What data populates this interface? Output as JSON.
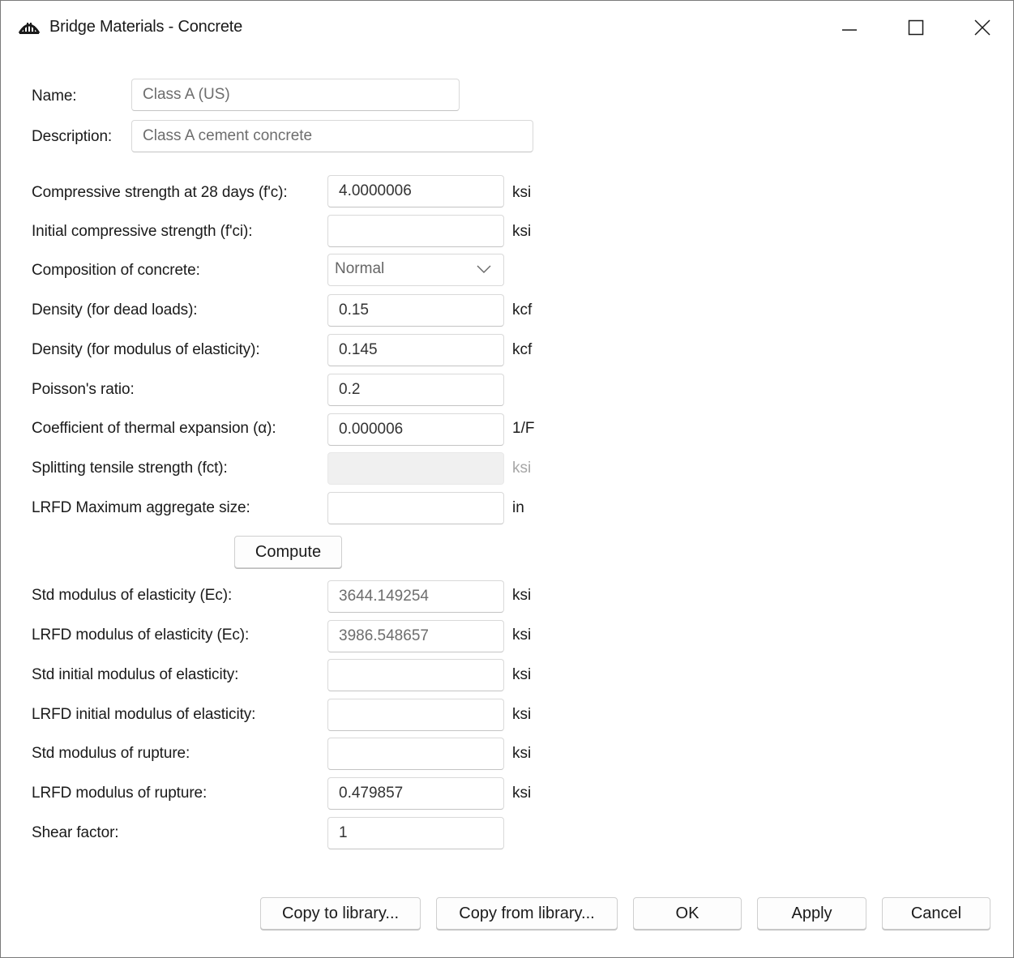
{
  "window": {
    "title": "Bridge Materials - Concrete",
    "app_icon": "bridge-icon",
    "controls": [
      "minimize-icon",
      "maximize-icon",
      "close-icon"
    ]
  },
  "identity": {
    "name_label": "Name:",
    "name_value": "Class A (US)",
    "description_label": "Description:",
    "description_value": "Class A cement concrete"
  },
  "properties": [
    {
      "label": "Compressive strength at 28 days (f'c):",
      "value": "4.0000006",
      "unit": "ksi"
    },
    {
      "label": "Initial compressive strength (f'ci):",
      "value": "",
      "unit": "ksi"
    },
    {
      "label": "Composition of concrete:",
      "value": "Normal",
      "unit": ""
    },
    {
      "label": "Density (for dead loads):",
      "value": "0.15",
      "unit": "kcf"
    },
    {
      "label": "Density (for modulus of elasticity):",
      "value": "0.145",
      "unit": "kcf"
    },
    {
      "label": "Poisson's ratio:",
      "value": "0.2",
      "unit": ""
    },
    {
      "label": "Coefficient of thermal expansion (α):",
      "value": "0.000006",
      "unit": "1/F"
    },
    {
      "label": "Splitting tensile strength (fct):",
      "value": "",
      "unit": "ksi"
    },
    {
      "label": "LRFD Maximum aggregate size:",
      "value": "",
      "unit": "in"
    }
  ],
  "compute_label": "Compute",
  "moduli": [
    {
      "label": "Std modulus of elasticity (Ec):",
      "value": "3644.149254",
      "unit": "ksi"
    },
    {
      "label": "LRFD modulus of elasticity (Ec):",
      "value": "3986.548657",
      "unit": "ksi"
    },
    {
      "label": "Std initial modulus of elasticity:",
      "value": "",
      "unit": "ksi"
    },
    {
      "label": "LRFD initial modulus of elasticity:",
      "value": "",
      "unit": "ksi"
    },
    {
      "label": "Std modulus of rupture:",
      "value": "",
      "unit": "ksi"
    },
    {
      "label": "LRFD modulus of rupture:",
      "value": "0.479857",
      "unit": "ksi"
    },
    {
      "label": "Shear factor:",
      "value": "1",
      "unit": ""
    }
  ],
  "buttons": {
    "copy_to": "Copy to library...",
    "copy_from": "Copy from library...",
    "ok": "OK",
    "apply": "Apply",
    "cancel": "Cancel"
  }
}
